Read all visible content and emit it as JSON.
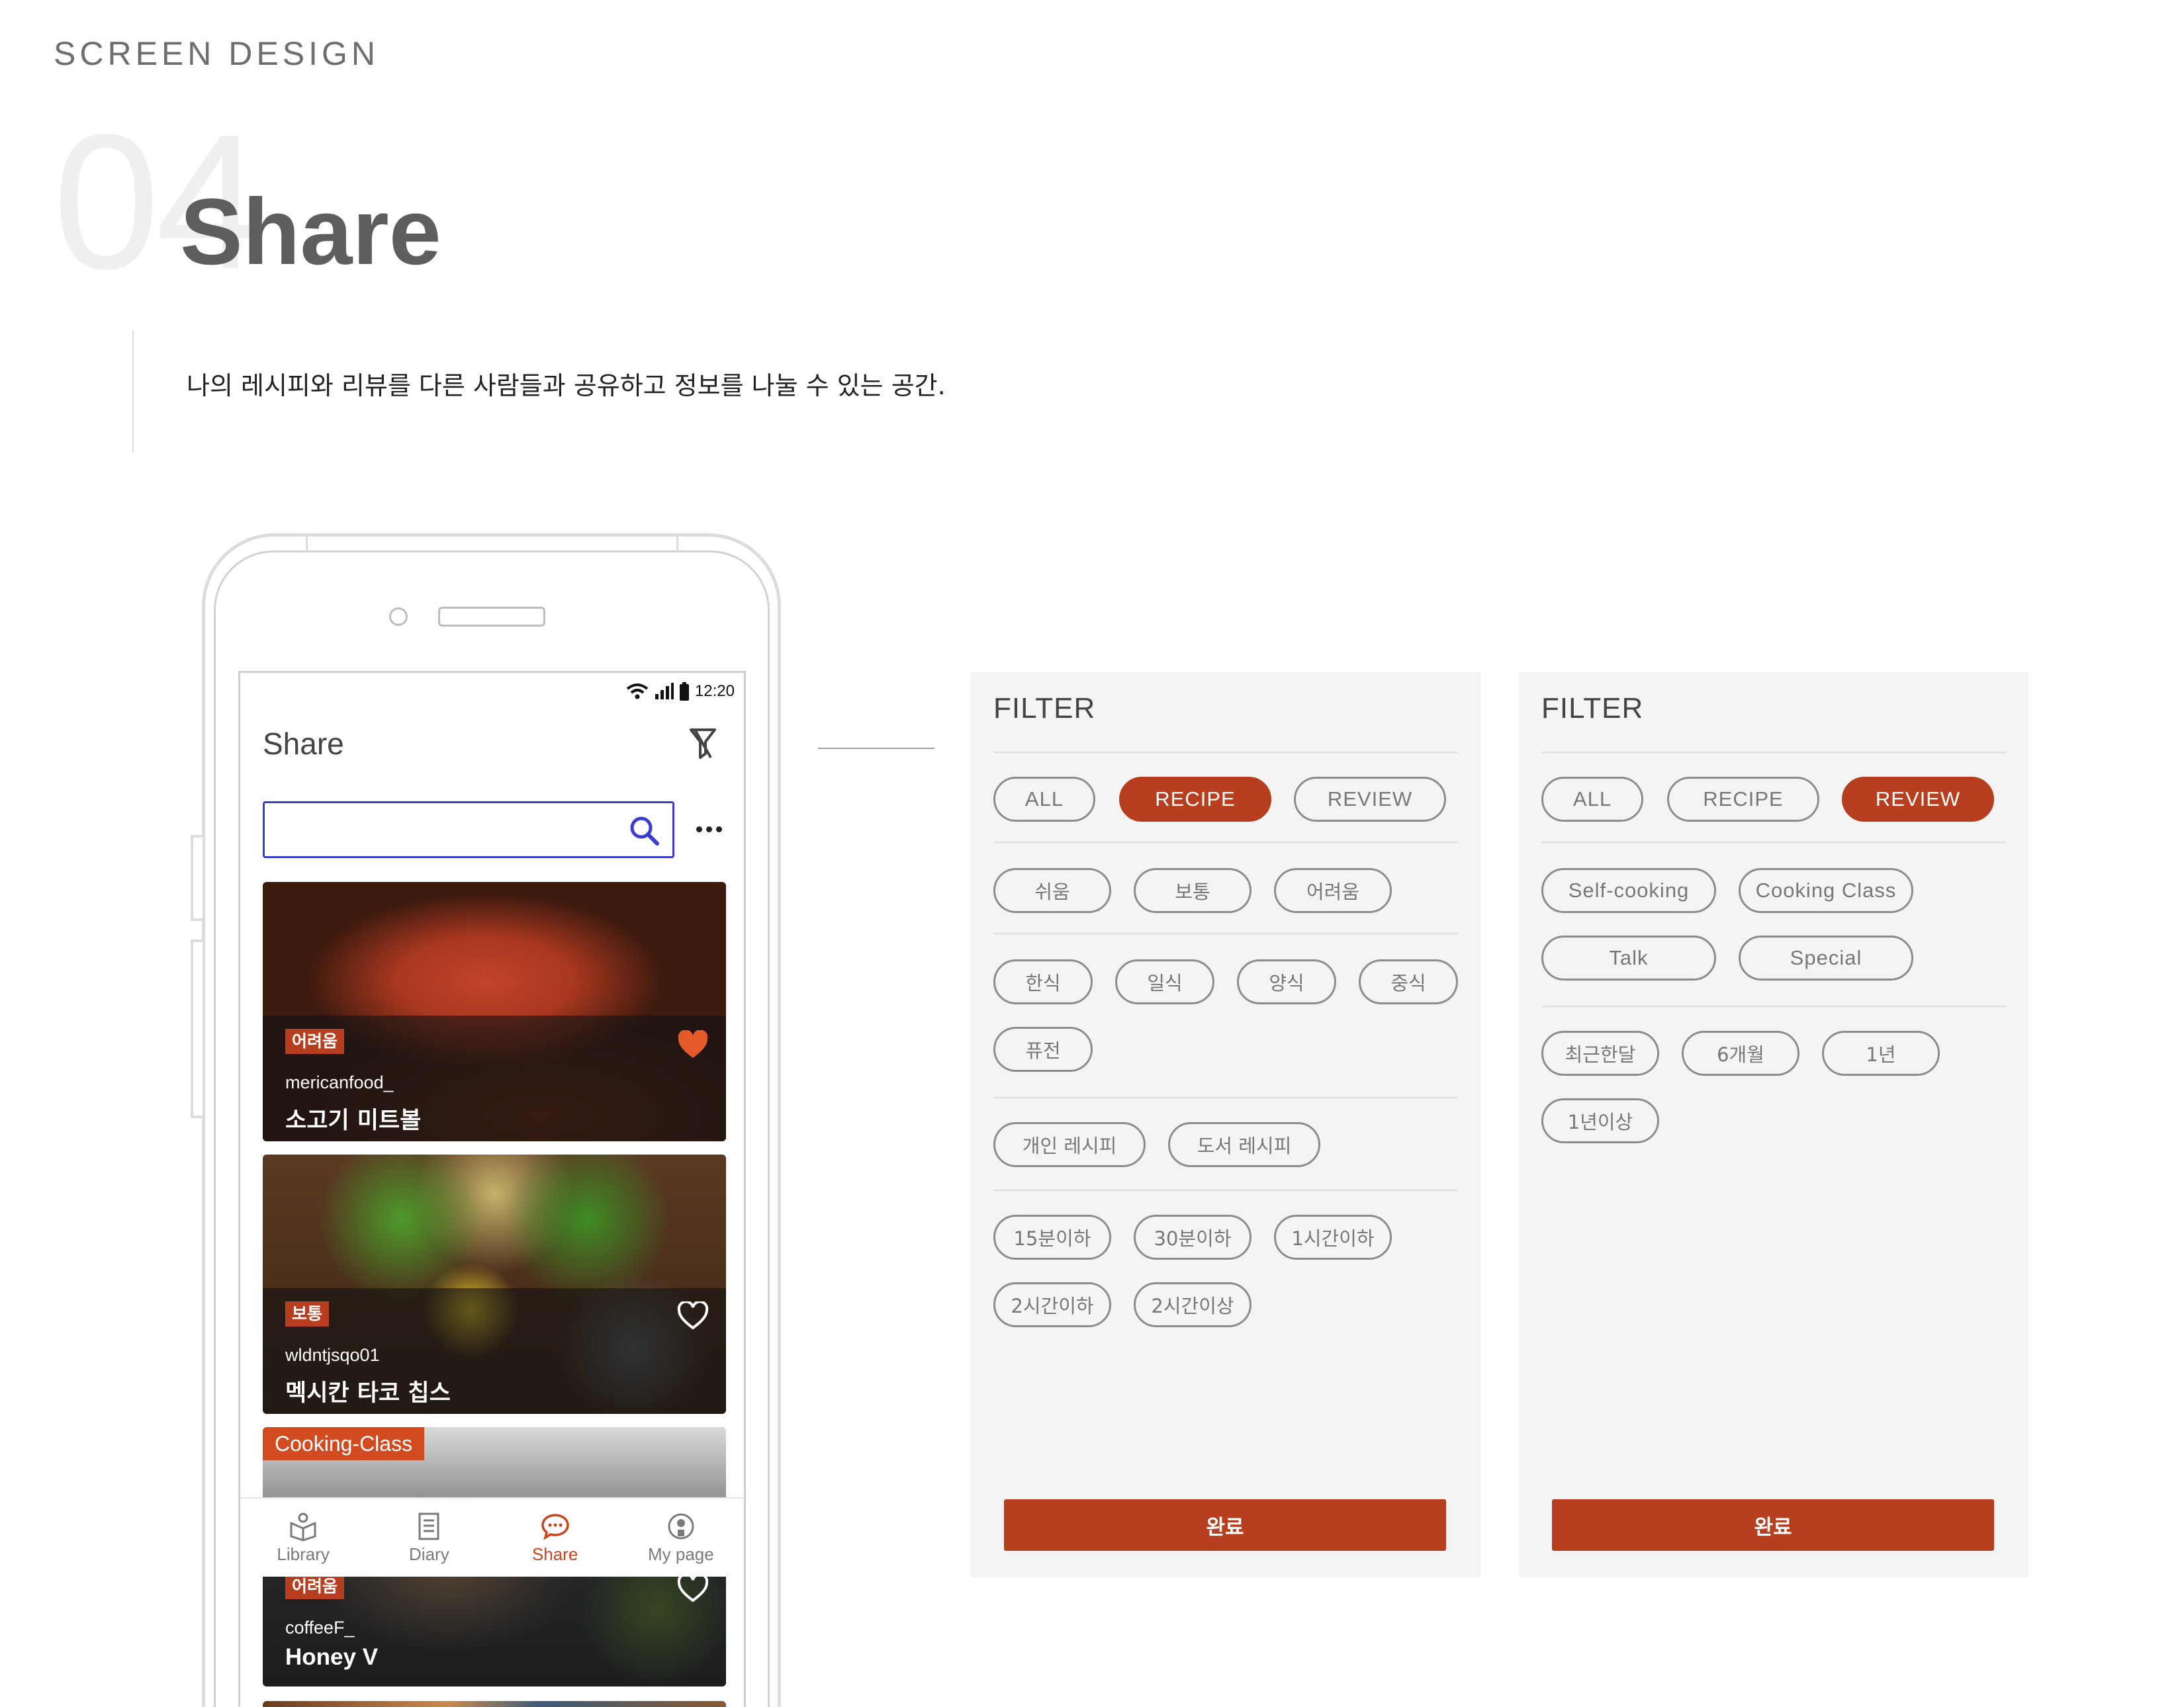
{
  "header": {
    "eyebrow": "SCREEN DESIGN",
    "section_number": "04",
    "section_title": "Share",
    "description": "나의 레시피와 리뷰를 다른 사람들과 공유하고 정보를 나눌 수 있는 공간."
  },
  "phone": {
    "status_time": "12:20",
    "app_title": "Share",
    "search": {
      "value": "",
      "placeholder": ""
    },
    "cards": [
      {
        "badge": "어려움",
        "user": "mericanfood_",
        "title": "소고기 미트볼",
        "liked": true
      },
      {
        "badge": "보통",
        "user": "wldntjsqo01",
        "title": "멕시칸 타코 칩스",
        "liked": false
      },
      {
        "tag": "Cooking-Class",
        "badge": "어려움",
        "user": "coffeeF_",
        "title": "Honey V",
        "liked": false
      }
    ],
    "nav": [
      {
        "label": "Library",
        "icon": "library-icon",
        "active": false
      },
      {
        "label": "Diary",
        "icon": "diary-icon",
        "active": false
      },
      {
        "label": "Share",
        "icon": "share-chat-icon",
        "active": true
      },
      {
        "label": "My page",
        "icon": "mypage-icon",
        "active": false
      }
    ]
  },
  "filter_recipe": {
    "title": "FILTER",
    "type_tabs": [
      "ALL",
      "RECIPE",
      "REVIEW"
    ],
    "active_tab": "RECIPE",
    "difficulty": [
      "쉬움",
      "보통",
      "어려움"
    ],
    "cuisine": [
      "한식",
      "일식",
      "양식",
      "중식",
      "퓨전"
    ],
    "source": [
      "개인 레시피",
      "도서 레시피"
    ],
    "time": [
      "15분이하",
      "30분이하",
      "1시간이하",
      "2시간이하",
      "2시간이상"
    ],
    "done_label": "완료"
  },
  "filter_review": {
    "title": "FILTER",
    "type_tabs": [
      "ALL",
      "RECIPE",
      "REVIEW"
    ],
    "active_tab": "REVIEW",
    "category": [
      "Self-cooking",
      "Cooking Class",
      "Talk",
      "Special"
    ],
    "period": [
      "최근한달",
      "6개월",
      "1년",
      "1년이상"
    ],
    "done_label": "완료"
  },
  "colors": {
    "accent": "#b73f1f",
    "search_border": "#3b3ccf",
    "panel_bg": "#f4f4f4",
    "chip_border": "#8c8c8c"
  }
}
